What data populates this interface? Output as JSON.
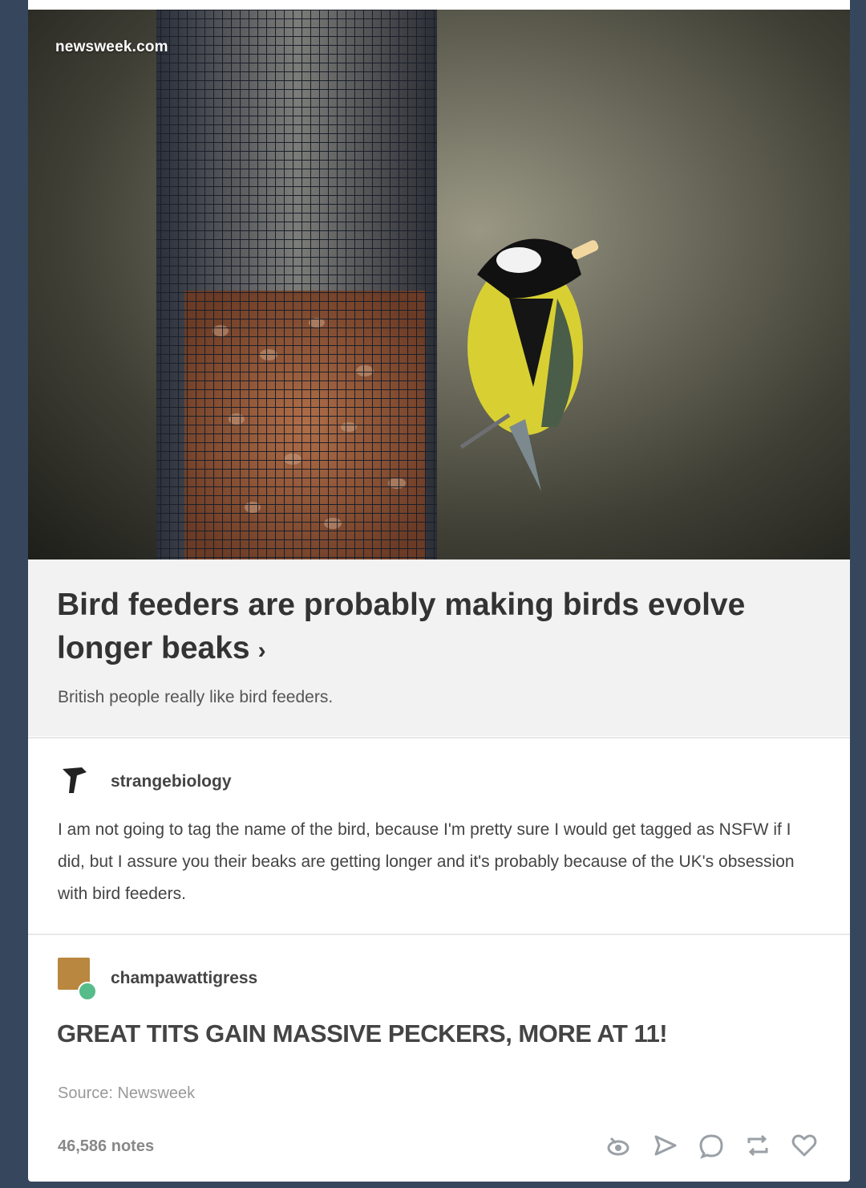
{
  "hero": {
    "site_label": "newsweek.com"
  },
  "link": {
    "title": "Bird feeders are probably making birds evolve longer beaks",
    "chevron": "›",
    "description": "British people really like bird feeders."
  },
  "reblogs": [
    {
      "username": "strangebiology",
      "text": "I am not going to tag the name of the bird, because I'm pretty sure I would get tagged as NSFW if I did, but I assure you their beaks are getting longer and it's probably because of the UK's obsession with bird feeders."
    },
    {
      "username": "champawattigress",
      "text": "GREAT TITS GAIN MASSIVE PECKERS, MORE AT 11!"
    }
  ],
  "footer": {
    "source": "Source: Newsweek",
    "notes": "46,586 notes"
  },
  "icons": {
    "view": "eye-icon",
    "share": "share-icon",
    "reply": "reply-icon",
    "reblog": "reblog-icon",
    "like": "heart-icon"
  }
}
